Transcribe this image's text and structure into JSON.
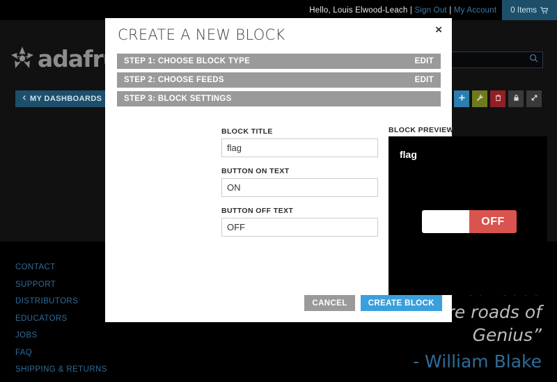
{
  "topbar": {
    "greeting": "Hello, Louis Elwood-Leach",
    "sep1": "|",
    "sign_out": "Sign Out",
    "sep2": "|",
    "my_account": "My Account",
    "cart_label": "0 Items",
    "cart_icon": "shopping-cart-icon",
    "accent_color": "#1d4f6b"
  },
  "brand": {
    "logo_text": "adafruit",
    "logo_icon": "adafruit-flower-icon"
  },
  "search": {
    "value": "",
    "placeholder": "",
    "icon": "search-icon"
  },
  "dashboard_bar": {
    "back_label": "MY DASHBOARDS",
    "back_icon": "chevron-left-icon",
    "tools": [
      {
        "name": "add-block-button",
        "icon": "plus-icon",
        "color": "#2a7fb0"
      },
      {
        "name": "edit-layout-button",
        "icon": "wrench-icon",
        "color": "#6f7a1e"
      },
      {
        "name": "delete-button",
        "icon": "trash-icon",
        "color": "#8f2025"
      },
      {
        "name": "privacy-button",
        "icon": "lock-icon",
        "color": "#3a3a3a"
      },
      {
        "name": "fullscreen-button",
        "icon": "expand-icon",
        "color": "#3a3a3a"
      }
    ]
  },
  "footer": {
    "links": [
      "CONTACT",
      "SUPPORT",
      "DISTRIBUTORS",
      "EDUCATORS",
      "JOBS",
      "FAQ",
      "SHIPPING & RETURNS"
    ]
  },
  "quote": {
    "text": "“Improvement makes straight roads, but the crooked roads without improvement are roads of Genius”",
    "author": "- William Blake",
    "author_color": "#2f6c99"
  },
  "modal": {
    "title": "CREATE A NEW BLOCK",
    "close_icon": "close-icon",
    "close_label": "×",
    "steps": [
      {
        "label": "STEP 1: CHOOSE BLOCK TYPE",
        "action": "EDIT"
      },
      {
        "label": "STEP 2: CHOOSE FEEDS",
        "action": "EDIT"
      },
      {
        "label": "STEP 3: BLOCK SETTINGS",
        "action": ""
      }
    ],
    "fields": [
      {
        "label": "BLOCK TITLE",
        "value": "flag",
        "placeholder": ""
      },
      {
        "label": "BUTTON ON TEXT",
        "value": "ON",
        "placeholder": ""
      },
      {
        "label": "BUTTON OFF TEXT",
        "value": "OFF",
        "placeholder": ""
      }
    ],
    "preview": {
      "label": "BLOCK PREVIEW",
      "block_title": "flag",
      "toggle_state": "OFF",
      "toggle_off_color": "#d9534f",
      "background": "#000000"
    },
    "buttons": {
      "cancel": "CANCEL",
      "create": "CREATE BLOCK",
      "create_color": "#3aa0dd"
    }
  }
}
